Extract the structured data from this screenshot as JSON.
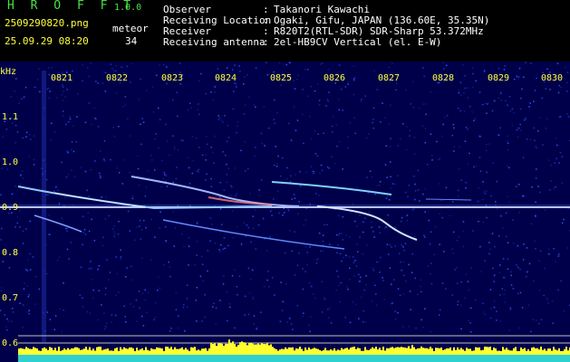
{
  "header": {
    "app_title": "H R O F F T",
    "app_version": "1.0.0",
    "file_name": "2509290820.png",
    "date_time": "25.09.29 08:20",
    "meteor_label": "meteor",
    "meteor_count": "34"
  },
  "info": [
    {
      "label": "Observer",
      "value": "Takanori Kawachi"
    },
    {
      "label": "Receiving Location",
      "value": "Ogaki, Gifu, JAPAN (136.60E, 35.35N)"
    },
    {
      "label": "Receiver",
      "value": "R820T2(RTL-SDR) SDR-Sharp 53.372MHz"
    },
    {
      "label": "Receiving antenna",
      "value": "2el-HB9CV Vertical (el. E-W)"
    }
  ],
  "spectrogram": {
    "unit_label": "kHz",
    "time_labels": [
      "0821",
      "0822",
      "0823",
      "0824",
      "0825",
      "0826",
      "0827",
      "0828",
      "0829",
      "0830"
    ],
    "freq_labels": [
      "1.1",
      "1.0",
      "0.9",
      "0.8",
      "0.7",
      "0.6"
    ],
    "colors": {
      "background": "#000050",
      "text": "#ffff3c",
      "carrier": "#d0d0ff",
      "echo": "#a0c8ff",
      "bars_yellow": "#ffff30",
      "bars_cyan": "#30d0d0"
    }
  }
}
